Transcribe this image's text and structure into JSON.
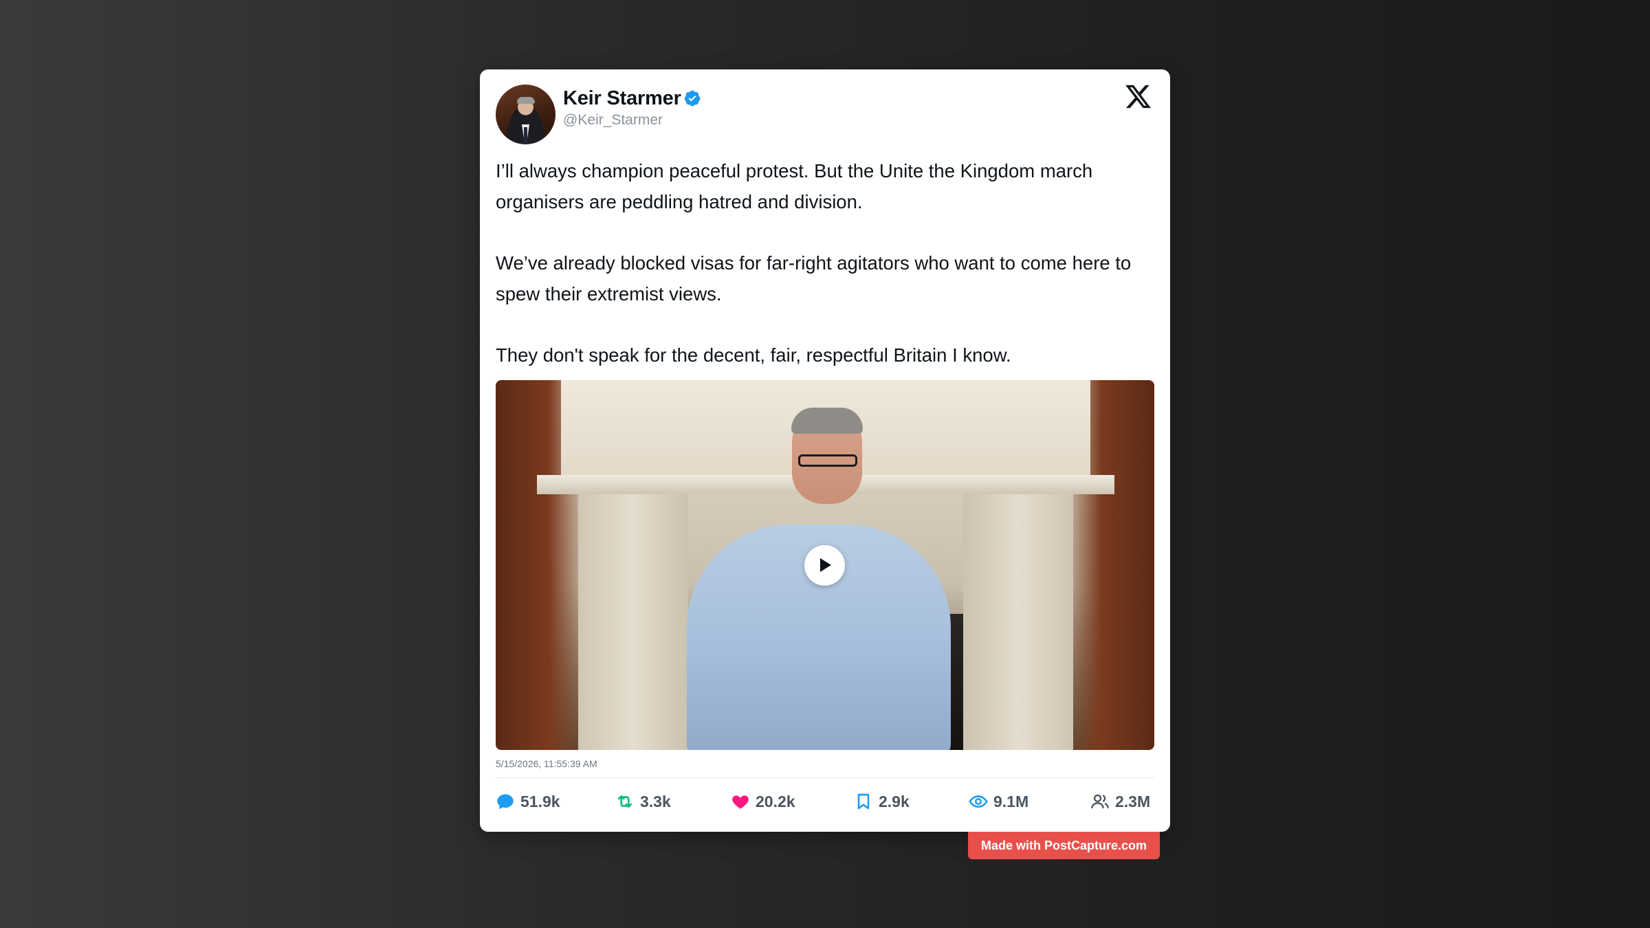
{
  "author": {
    "name": "Keir Starmer",
    "handle": "@Keir_Starmer"
  },
  "post": {
    "paragraphs": [
      "I’ll always champion peaceful protest. But the Unite the Kingdom march organisers are peddling hatred and division.",
      "We’ve already blocked visas for far-right agitators who want to come here to spew their extremist views.",
      "They don't speak for the decent, fair, respectful Britain I know."
    ],
    "timestamp": "5/15/2026, 11:55:39 AM"
  },
  "stats": {
    "replies": "51.9k",
    "reposts": "3.3k",
    "likes": "20.2k",
    "bookmarks": "2.9k",
    "views": "9.1M",
    "followers": "2.3M"
  },
  "branding": {
    "badge": "Made with PostCapture.com"
  },
  "colors": {
    "verified": "#1d9bf0",
    "reply_icon": "#1d9bf0",
    "repost_icon": "#00ba7c",
    "like_icon": "#f91880",
    "bookmark_icon": "#1d9bf0",
    "views_icon": "#1d9bf0",
    "badge_bg": "#e9504b"
  }
}
